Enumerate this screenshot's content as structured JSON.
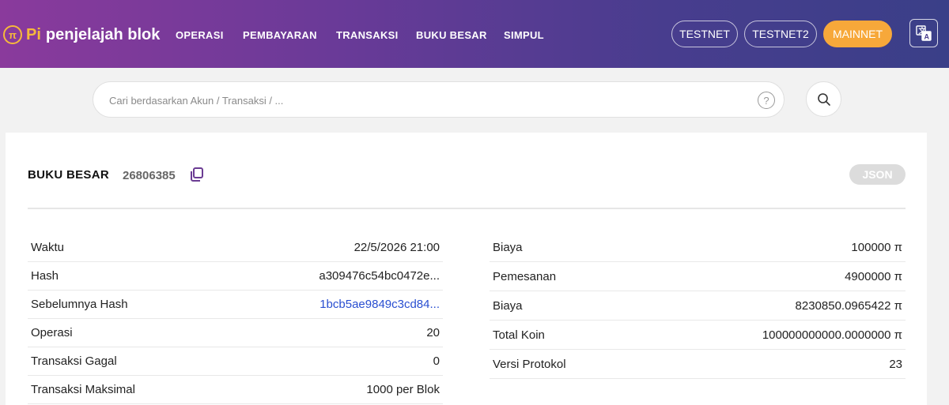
{
  "header": {
    "logo_symbol": "π",
    "logo_pi": "Pi",
    "logo_text": "penjelajah blok",
    "nav": [
      "OPERASI",
      "PEMBAYARAN",
      "TRANSAKSI",
      "BUKU BESAR",
      "SIMPUL"
    ],
    "networks": [
      "TESTNET",
      "TESTNET2",
      "MAINNET"
    ],
    "active_network": "MAINNET",
    "language_icon": "translate-icon"
  },
  "search": {
    "placeholder": "Cari berdasarkan Akun / Transaksi / ...",
    "value": "",
    "help_icon": "question-icon",
    "help_symbol": "?",
    "search_icon": "search-icon"
  },
  "ledger": {
    "title": "BUKU BESAR",
    "number": "26806385",
    "json_label": "JSON",
    "left": [
      {
        "label": "Waktu",
        "value": "22/5/2026 21:00"
      },
      {
        "label": "Hash",
        "value": "a309476c54bc0472e..."
      },
      {
        "label": "Sebelumnya Hash",
        "value": "1bcb5ae9849c3cd84...",
        "link": true
      },
      {
        "label": "Operasi",
        "value": "20"
      },
      {
        "label": "Transaksi Gagal",
        "value": "0"
      },
      {
        "label": "Transaksi Maksimal",
        "value": "1000 per Blok"
      }
    ],
    "right": [
      {
        "label": "Biaya",
        "value": "100000 π"
      },
      {
        "label": "Pemesanan",
        "value": "4900000 π"
      },
      {
        "label": "Biaya",
        "value": "8230850.0965422 π"
      },
      {
        "label": "Total Koin",
        "value": "100000000000.0000000 π"
      },
      {
        "label": "Versi Protokol",
        "value": "23"
      }
    ]
  },
  "colors": {
    "accent": "#f7a83a",
    "link": "#2a4fd1",
    "header_start": "#8a3a9c",
    "header_end": "#3a3f88"
  }
}
